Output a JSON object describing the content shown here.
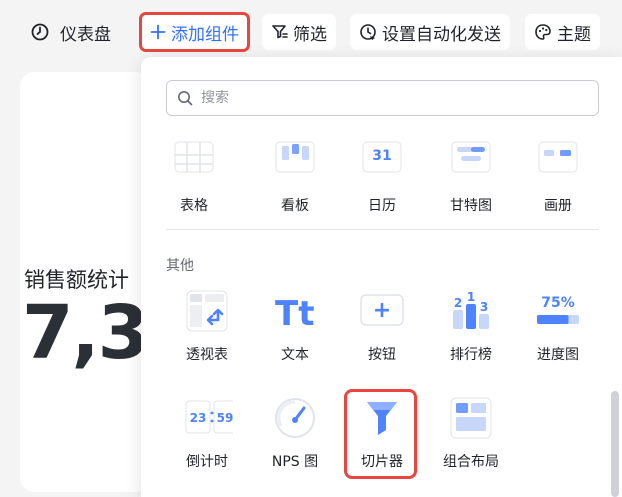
{
  "toolbar": {
    "dashboard_label": "仪表盘",
    "add_component_label": "添加组件",
    "filter_label": "筛选",
    "auto_send_label": "设置自动化发送",
    "theme_label": "主题"
  },
  "card": {
    "title": "销售额统计",
    "value": "7,3"
  },
  "panel": {
    "search_placeholder": "搜索",
    "top_row": [
      {
        "label": "表格",
        "icon": "table-icon"
      },
      {
        "label": "看板",
        "icon": "kanban-icon"
      },
      {
        "label": "日历",
        "icon": "calendar-icon",
        "icon_text": "31"
      },
      {
        "label": "甘特图",
        "icon": "gantt-icon"
      },
      {
        "label": "画册",
        "icon": "gallery-icon"
      }
    ],
    "other_section_title": "其他",
    "other_row1": [
      {
        "label": "透视表",
        "icon": "pivot-table-icon"
      },
      {
        "label": "文本",
        "icon": "text-icon",
        "icon_text": "Tt"
      },
      {
        "label": "按钮",
        "icon": "button-icon",
        "icon_text": "+"
      },
      {
        "label": "排行榜",
        "icon": "ranking-icon",
        "icon_text": [
          "2",
          "1",
          "3"
        ]
      },
      {
        "label": "进度图",
        "icon": "progress-icon",
        "icon_text": "75%",
        "progress": 0.75
      }
    ],
    "other_row2": [
      {
        "label": "倒计时",
        "icon": "countdown-icon",
        "icon_text": [
          "23",
          "59"
        ]
      },
      {
        "label": "NPS 图",
        "icon": "nps-gauge-icon"
      },
      {
        "label": "切片器",
        "icon": "slicer-funnel-icon"
      },
      {
        "label": "组合布局",
        "icon": "layout-combo-icon"
      }
    ]
  },
  "colors": {
    "accent": "#3370ff",
    "highlight": "#e8473f",
    "icon_blue": "#4e83fd",
    "icon_light": "#c7d6fb"
  }
}
